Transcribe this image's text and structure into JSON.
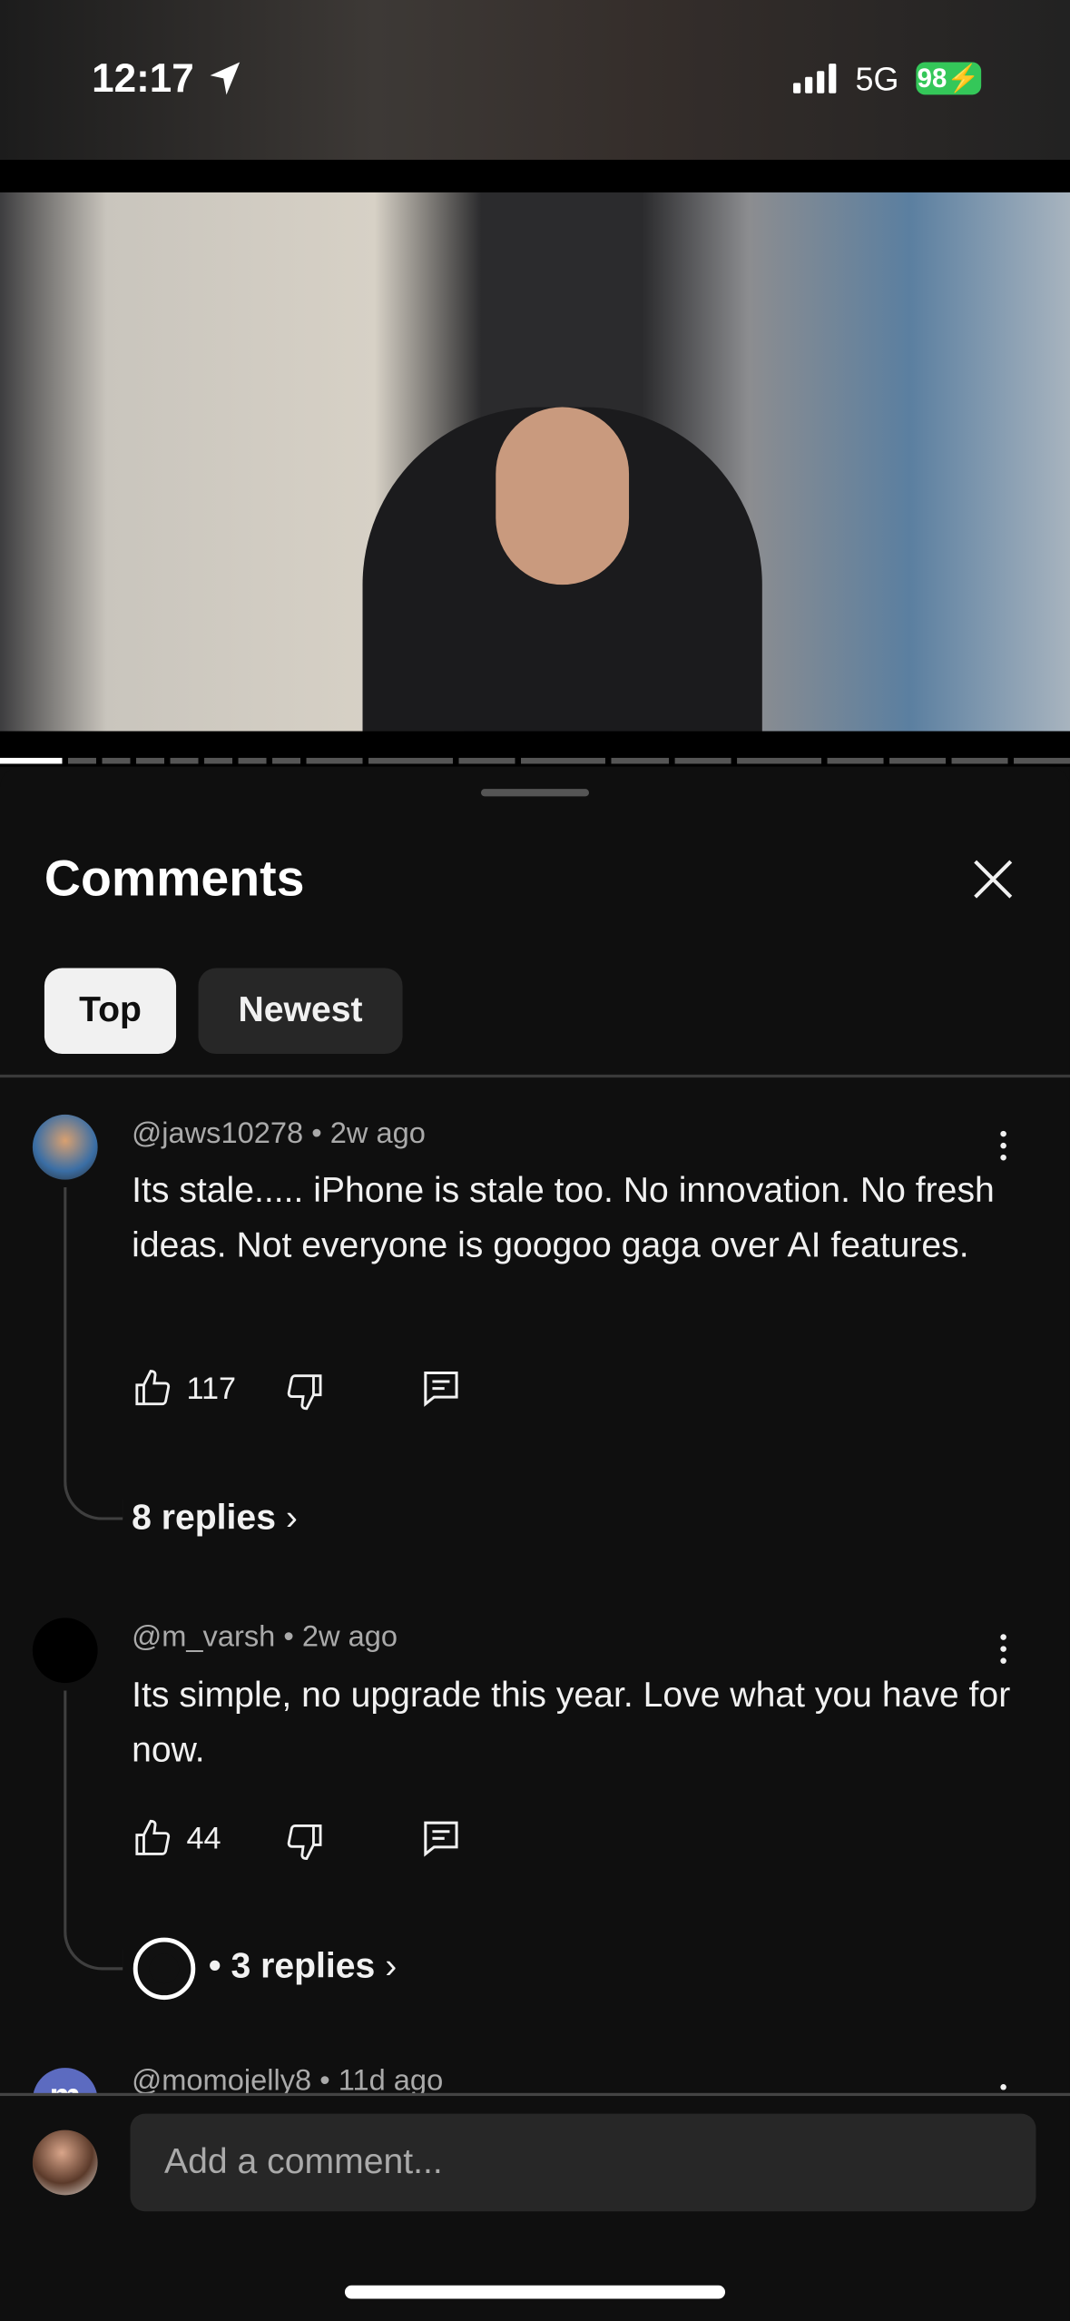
{
  "status_bar": {
    "time": "12:17",
    "network": "5G",
    "battery": "98",
    "battery_color": "#34c759"
  },
  "video": {
    "progress_percent": 5
  },
  "comments_panel": {
    "title": "Comments",
    "tabs": [
      {
        "label": "Top",
        "selected": true
      },
      {
        "label": "Newest",
        "selected": false
      }
    ],
    "comments": [
      {
        "author": "@jaws10278",
        "age": "2w ago",
        "text": "Its stale..... iPhone is stale too. No innovation. No fresh ideas. Not everyone is googoo gaga over AI features.",
        "likes": "117",
        "replies": "8 replies"
      },
      {
        "author": "@m_varsh",
        "age": "2w ago",
        "text": "Its simple, no upgrade this year. Love what you have for now.",
        "likes": "44",
        "replies": "• 3 replies"
      },
      {
        "author": "@momojelly8",
        "age": "11d ago",
        "avatar_letter": "m",
        "avatar_color": "#5c6bc0"
      }
    ],
    "add_comment_placeholder": "Add a comment..."
  }
}
